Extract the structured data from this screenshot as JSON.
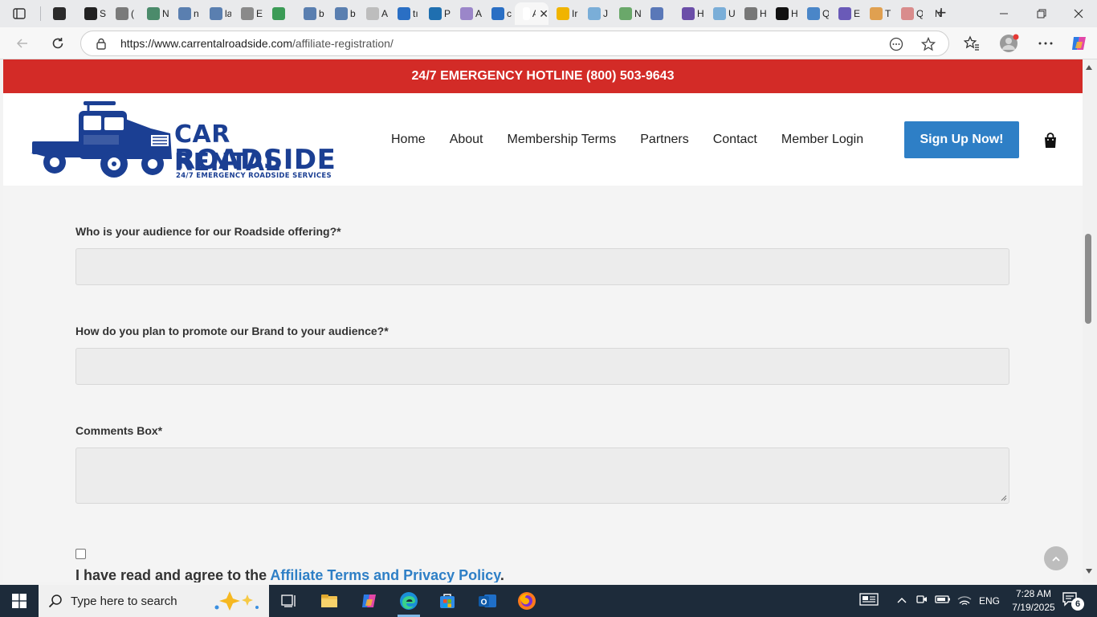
{
  "browser": {
    "tabs": [
      {
        "title": "",
        "icon": "window-icon",
        "color": "#2b2b2b"
      },
      {
        "title": "S",
        "icon": "chatgpt-icon",
        "color": "#222222"
      },
      {
        "title": "(",
        "icon": "doc-icon",
        "color": "#7a7a7a"
      },
      {
        "title": "N",
        "icon": "chart-icon",
        "color": "#4b8b6b"
      },
      {
        "title": "n",
        "icon": "search-icon",
        "color": "#5a7fb0"
      },
      {
        "title": "la",
        "icon": "search-icon",
        "color": "#5a7fb0"
      },
      {
        "title": "E",
        "icon": "n-icon",
        "color": "#8a8a8a"
      },
      {
        "title": "",
        "icon": "globe-icon",
        "color": "#3b9b56"
      },
      {
        "title": "b",
        "icon": "search-icon",
        "color": "#5a7fb0"
      },
      {
        "title": "b",
        "icon": "search-icon",
        "color": "#5a7fb0"
      },
      {
        "title": "A",
        "icon": "page-icon",
        "color": "#bdbdbd"
      },
      {
        "title": "tı",
        "icon": "search-icon",
        "color": "#2a6fc4"
      },
      {
        "title": "P",
        "icon": "xf-icon",
        "color": "#1f6fb0"
      },
      {
        "title": "A",
        "icon": "circle-icon",
        "color": "#9b86c9"
      },
      {
        "title": "c",
        "icon": "search-icon",
        "color": "#2a6fc4"
      },
      {
        "title": "A",
        "icon": "page-icon",
        "color": "#ffffff"
      },
      {
        "title": "Ir",
        "icon": "arrow-icon",
        "color": "#f0b400"
      },
      {
        "title": "J",
        "icon": "s-icon",
        "color": "#7aaed8"
      },
      {
        "title": "N",
        "icon": "circle-icon",
        "color": "#6aa86a"
      },
      {
        "title": "",
        "icon": "gear-icon",
        "color": "#5a78b8"
      },
      {
        "title": "H",
        "icon": "u-icon",
        "color": "#6b4ea8"
      },
      {
        "title": "U",
        "icon": "pin-icon",
        "color": "#7aaed8"
      },
      {
        "title": "H",
        "icon": "globe-icon",
        "color": "#777777"
      },
      {
        "title": "H",
        "icon": "menu-icon",
        "color": "#111111"
      },
      {
        "title": "Q",
        "icon": "stack-icon",
        "color": "#4a86c8"
      },
      {
        "title": "E",
        "icon": "square-icon",
        "color": "#6a5ab8"
      },
      {
        "title": "T",
        "icon": "circle-icon",
        "color": "#e0a050"
      },
      {
        "title": "Q",
        "icon": "square-icon",
        "color": "#d98c8c"
      },
      {
        "title": "N",
        "icon": "",
        "color": ""
      }
    ],
    "url_host": "https://www.carrentalroadside.com",
    "url_path": "/affiliate-registration/"
  },
  "site": {
    "hotline": "24/7 EMERGENCY HOTLINE (800) 503-9643",
    "logo_word1": "CAR RENTAL",
    "logo_word2": "ROADSIDE",
    "logo_tagline": "24/7 EMERGENCY ROADSIDE SERVICES",
    "nav": [
      "Home",
      "About",
      "Membership Terms",
      "Partners",
      "Contact",
      "Member Login"
    ],
    "cta": "Sign Up Now!",
    "colors": {
      "hotline": "#d32b27",
      "brand": "#1b3f93",
      "cta": "#2e7fc6"
    }
  },
  "form": {
    "q_audience": "Who is your audience for our Roadside offering?*",
    "q_promote": "How do you plan to promote our Brand to your audience?*",
    "q_comments": "Comments Box*",
    "agree_prefix": "I have read and agree to the ",
    "agree_link": "Affiliate Terms and Privacy Policy",
    "agree_suffix": "."
  },
  "taskbar": {
    "search_placeholder": "Type here to search",
    "language": "ENG",
    "time": "7:28 AM",
    "date": "7/19/2025",
    "notifications": "6"
  }
}
